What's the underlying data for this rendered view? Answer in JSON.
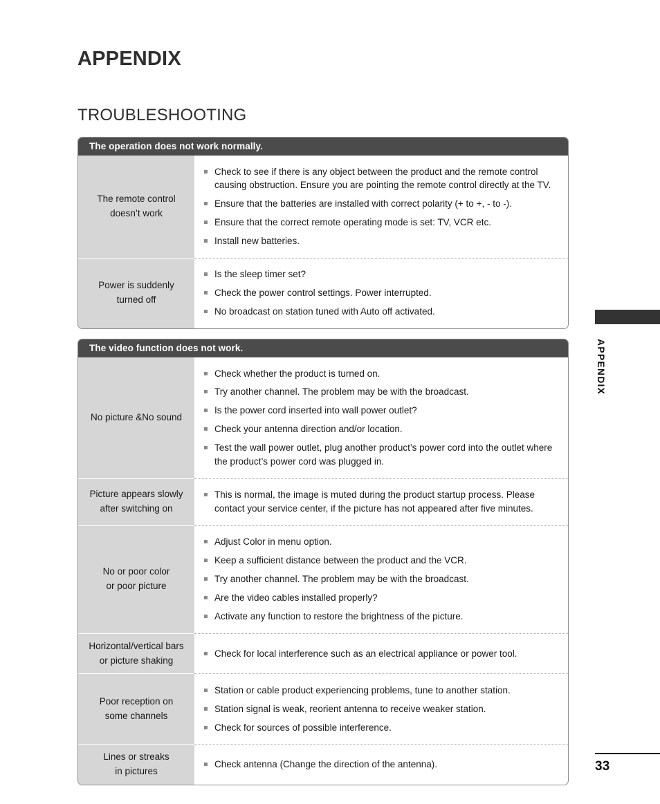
{
  "page": {
    "title": "APPENDIX",
    "section_title": "TROUBLESHOOTING",
    "side_tab_label": "APPENDIX",
    "page_number": "33"
  },
  "tables": [
    {
      "header": "The operation does not work normally.",
      "rows": [
        {
          "label_line1": "The remote control",
          "label_line2": "doesn’t work",
          "items": [
            "Check to see if there is any object between the product and the remote control causing obstruction. Ensure you are pointing the remote control directly at the TV.",
            "Ensure that the batteries are installed with correct polarity (+ to +, - to -).",
            "Ensure that the correct remote operating mode is set: TV, VCR etc.",
            "Install new batteries."
          ]
        },
        {
          "label_line1": "Power is suddenly",
          "label_line2": "turned off",
          "items": [
            "Is the sleep timer set?",
            "Check the power control settings. Power interrupted.",
            "No broadcast on station tuned with Auto off activated."
          ]
        }
      ]
    },
    {
      "header": "The video function does not work.",
      "rows": [
        {
          "label_line1": "No picture &No sound",
          "label_line2": "",
          "items": [
            "Check whether the product is turned on.",
            "Try another channel. The problem may be with the broadcast.",
            "Is the power cord inserted into wall power outlet?",
            "Check your antenna direction and/or location.",
            "Test the wall power outlet, plug another product’s power cord into the outlet where the product’s power cord was plugged in."
          ]
        },
        {
          "label_line1": "Picture appears slowly",
          "label_line2": "after switching on",
          "items": [
            "This is normal, the image is muted during the product startup process. Please contact your service center, if the picture has not appeared after five minutes."
          ]
        },
        {
          "label_line1": "No or poor color",
          "label_line2": "or poor picture",
          "items": [
            "Adjust Color in menu option.",
            "Keep a sufficient distance between the product and the VCR.",
            "Try another channel. The problem may be with the broadcast.",
            "Are the video cables installed properly?",
            "Activate any function to restore the brightness of the picture."
          ]
        },
        {
          "label_line1": "Horizontal/vertical bars",
          "label_line2": "or picture shaking",
          "items": [
            "Check for local interference such as an electrical appliance or power tool."
          ]
        },
        {
          "label_line1": "Poor reception on",
          "label_line2": "some channels",
          "items": [
            "Station or cable product experiencing problems, tune to another station.",
            "Station signal is weak, reorient antenna to receive weaker station.",
            "Check for sources of possible interference."
          ]
        },
        {
          "label_line1": "Lines or streaks",
          "label_line2": "in pictures",
          "items": [
            "Check antenna (Change the direction of the antenna)."
          ]
        }
      ]
    }
  ],
  "colors": {
    "header_bg": "#4b4b4b",
    "label_bg": "#d6d6d6",
    "table_border": "#8c8c8c",
    "bullet": "#8a8a8a",
    "side_tab": "#333333"
  }
}
